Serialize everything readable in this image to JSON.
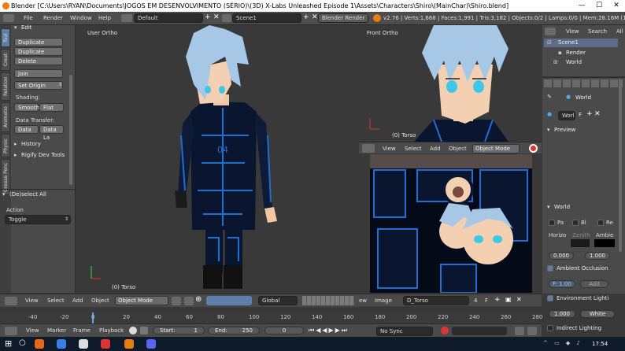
{
  "titlebar": {
    "title": "Blender [C:\\Users\\RYAN\\Documents\\JOGOS EM DESENVOLVIMENTO (SÉRIO)\\(3D) X-Labs Unleashed Episode 1\\Assets\\Characters\\Shiro\\(MainChar)\\Shiro.blend]"
  },
  "infobar": {
    "menus": [
      "File",
      "Render",
      "Window",
      "Help"
    ],
    "layout": "Default",
    "scene": "Scene1",
    "engine": "Blender Render",
    "stats": "v2.76 | Verts:1,668 | Faces:1,991 | Tris:3,182 | Objects:0/2 | Lamps:0/0 | Mem:28.16M (11.14M"
  },
  "toolshelf": {
    "tabs": [
      "Tool",
      "Creat",
      "Relation",
      "Animatio",
      "Physic",
      "Grease Penc"
    ],
    "edit_header": "Edit",
    "buttons": [
      "Duplicate",
      "Duplicate Linked",
      "Delete",
      "Join",
      "Set Origin"
    ],
    "shading_label": "Shading:",
    "smooth": "Smooth",
    "flat": "Flat",
    "data_transfer_label": "Data Transfer:",
    "data": "Data",
    "data_la": "Data La",
    "history": "History",
    "rigify": "Rigify Dev Tools",
    "operator_title": "(De)select All",
    "action_label": "Action",
    "action_value": "Toggle"
  },
  "viewport_user": {
    "label": "User Ortho",
    "object": "(0) Torso",
    "jacket_text": "04"
  },
  "viewport_front": {
    "label": "Front Ortho",
    "object": "(0) Torso"
  },
  "front_header": {
    "menus": [
      "View",
      "Select",
      "Add",
      "Object"
    ],
    "mode": "Object Mode"
  },
  "image_editor": {
    "menus": [
      "ew",
      "Image"
    ],
    "image_name": "D_Torso",
    "users": "4",
    "f": "F"
  },
  "outliner": {
    "menus": [
      "View",
      "Search",
      "All"
    ],
    "items": [
      "Scene1",
      "Render",
      "World"
    ]
  },
  "properties": {
    "world_name": "World",
    "world_field": "Worl",
    "preview": "Preview",
    "world_panel": "World",
    "checks": [
      "Pa",
      "Bl",
      "Re"
    ],
    "horizon": "Horizo",
    "zenith": "Zenith",
    "ambient": "Ambie",
    "val1": "0.000",
    "val2": "1.000",
    "ambient_occlusion": "Ambient Occlusion",
    "factor": "F: 1.00",
    "add": "Add",
    "env_lighting": "Environment Lighti",
    "env_val": "1.000",
    "white": "White",
    "indirect": "Indirect Lighting"
  },
  "view3d_header": {
    "menus": [
      "View",
      "Select",
      "Add",
      "Object"
    ],
    "mode": "Object Mode",
    "orientation": "Global"
  },
  "ruler": {
    "ticks": [
      "-40",
      "-20",
      "0",
      "20",
      "40",
      "60",
      "80",
      "100",
      "120",
      "140",
      "160",
      "180",
      "200",
      "220",
      "240",
      "260",
      "280"
    ]
  },
  "timeline": {
    "menus": [
      "View",
      "Marker",
      "Frame",
      "Playback"
    ],
    "start_label": "Start:",
    "start_val": "1",
    "end_label": "End:",
    "end_val": "250",
    "current": "0",
    "sync": "No Sync"
  },
  "taskbar": {
    "time": "17:54"
  },
  "colors": {
    "accent": "#5d7ea8",
    "char_hair": "#a6c8e6",
    "outfit": "#0a1530",
    "neon": "#1f6fd0"
  }
}
